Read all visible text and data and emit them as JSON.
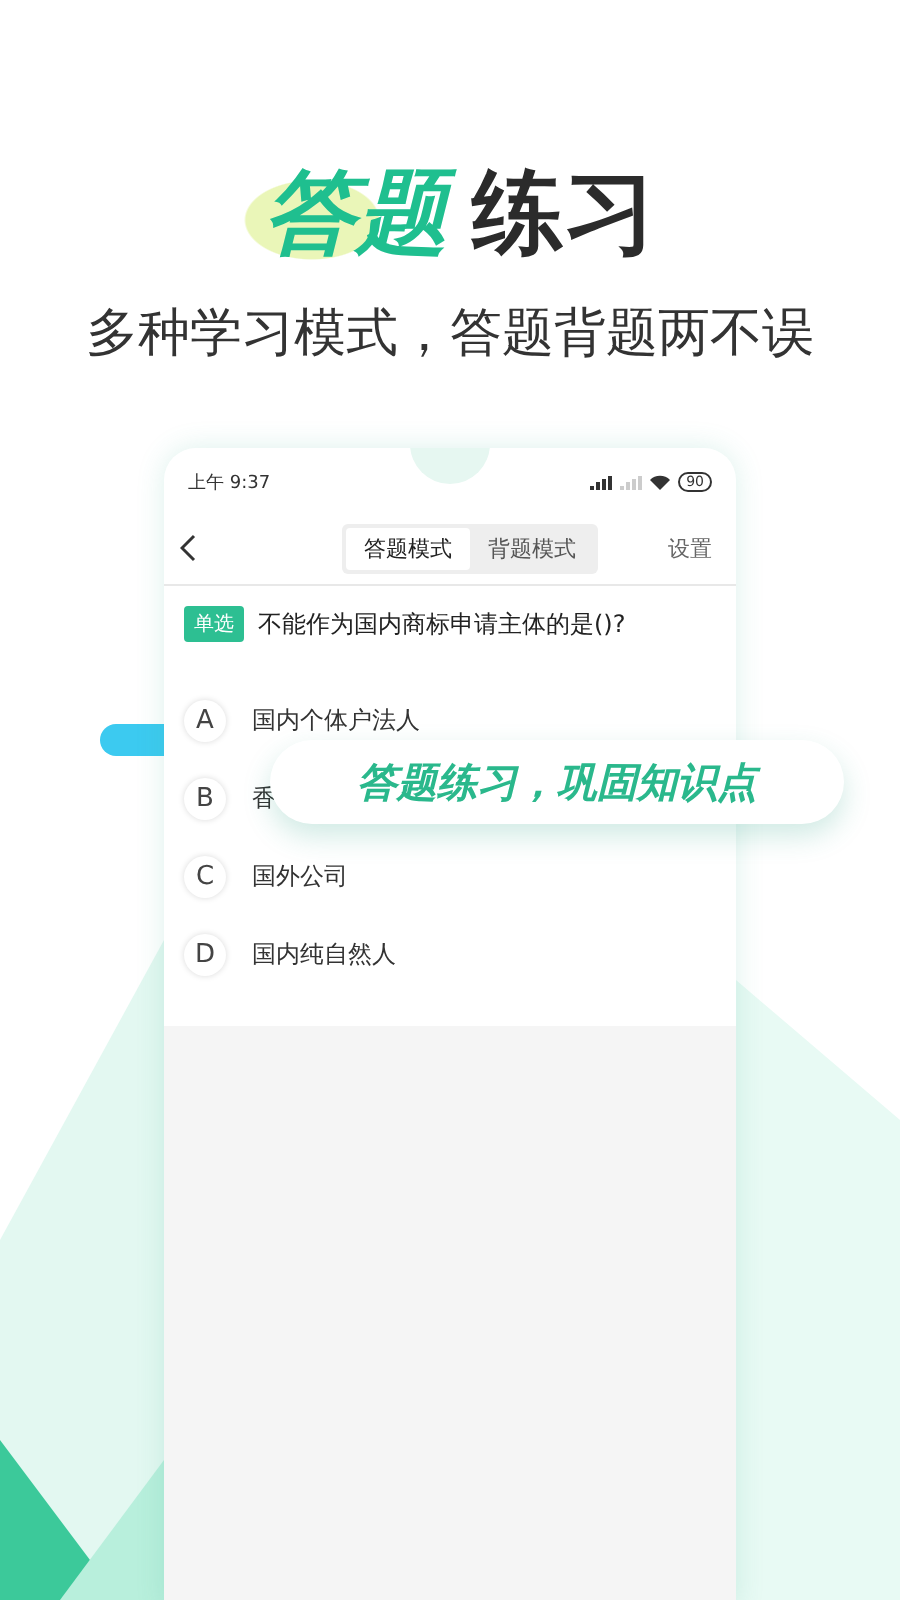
{
  "headline": {
    "highlight": "答题",
    "rest": "练习"
  },
  "subtitle": "多种学习模式，答题背题两不误",
  "status_bar": {
    "time": "上午 9:37",
    "battery": "90"
  },
  "nav": {
    "tabs": [
      {
        "label": "答题模式",
        "selected": true
      },
      {
        "label": "背题模式",
        "selected": false
      }
    ],
    "action": "设置"
  },
  "question": {
    "tag": "单选",
    "text": "不能作为国内商标申请主体的是()?"
  },
  "options": [
    {
      "letter": "A",
      "text": "国内个体户法人"
    },
    {
      "letter": "B",
      "text": "香"
    },
    {
      "letter": "C",
      "text": "国外公司"
    },
    {
      "letter": "D",
      "text": "国内纯自然人"
    }
  ],
  "callout": "答题练习，巩固知识点"
}
